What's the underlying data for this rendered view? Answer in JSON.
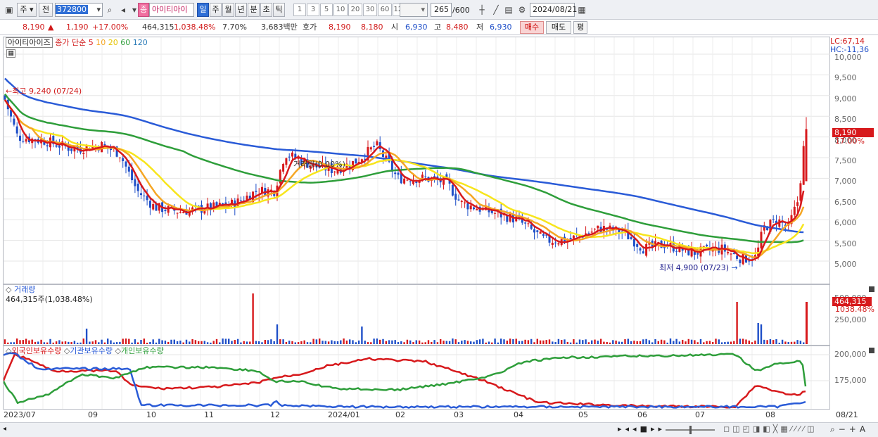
{
  "toolbar": {
    "market_label": "주",
    "prev_label": "전",
    "code": "372800",
    "stock_name": "아이티아이",
    "stock_badge": "종",
    "period_tabs": [
      "일",
      "주",
      "월",
      "년",
      "분",
      "초",
      "틱"
    ],
    "interval_options": [
      "1",
      "3",
      "5",
      "10",
      "20",
      "30",
      "60",
      "120"
    ],
    "count_value": "265",
    "count_max": "/600",
    "date": "2024/08/21"
  },
  "quote": {
    "price": "8,190",
    "change_arrow": "▲",
    "change": "1,190",
    "change_pct": "+17.00%",
    "volume": "464,315",
    "volume_ratio": "1,038.48%",
    "turnover": "7.70%",
    "amount": "3,683백만",
    "ask_label": "호가",
    "ask1": "8,190",
    "bid1": "8,180",
    "open_label": "시",
    "open": "6,930",
    "high_label": "고",
    "high": "8,480",
    "low_label": "저",
    "low": "6,930",
    "buy_button": "매수",
    "sell_button": "매도",
    "eval_button": "평"
  },
  "price_panel": {
    "legend_name": "아이티아이즈",
    "legend_type": "종가 단순",
    "ma_labels": [
      "5",
      "10",
      "20",
      "60",
      "120"
    ],
    "ma_colors": [
      "#d7191c",
      "#f5a623",
      "#f7e51c",
      "#2e9e3a",
      "#2a5bd7"
    ],
    "lc": "LC:67,14",
    "hc": "HC:-11,36",
    "high_note": "최고 9,240 (07/24)",
    "low_note": "최저 4,900 (07/23)",
    "mid_note": "거래량(0.00%)",
    "last_price_tag": "8,190",
    "last_pct_tag": "17.00%",
    "y_ticks": [
      "10,000",
      "9,500",
      "9,000",
      "8,500",
      "8,000",
      "7,500",
      "7,000",
      "6,500",
      "6,000",
      "5,500",
      "5,000"
    ]
  },
  "volume_panel": {
    "title": "거래량",
    "value": "464,315주(1,038.48%)",
    "y_ticks": [
      "500,000",
      "250,000"
    ],
    "last_tag": "464,315",
    "last_pct": "1038.48%"
  },
  "holdings_panel": {
    "legend": [
      "외국인보유수량",
      "기관보유수량",
      "개인보유수량"
    ],
    "colors": [
      "#d7191c",
      "#2a5bd7",
      "#2e9e3a"
    ],
    "y_ticks": [
      "200,000",
      "175,000"
    ]
  },
  "x_axis": {
    "labels": [
      "2023/07",
      "09",
      "10",
      "11",
      "12",
      "2024/01",
      "02",
      "03",
      "04",
      "05",
      "06",
      "07",
      "08"
    ],
    "end_label": "08/21"
  }
}
